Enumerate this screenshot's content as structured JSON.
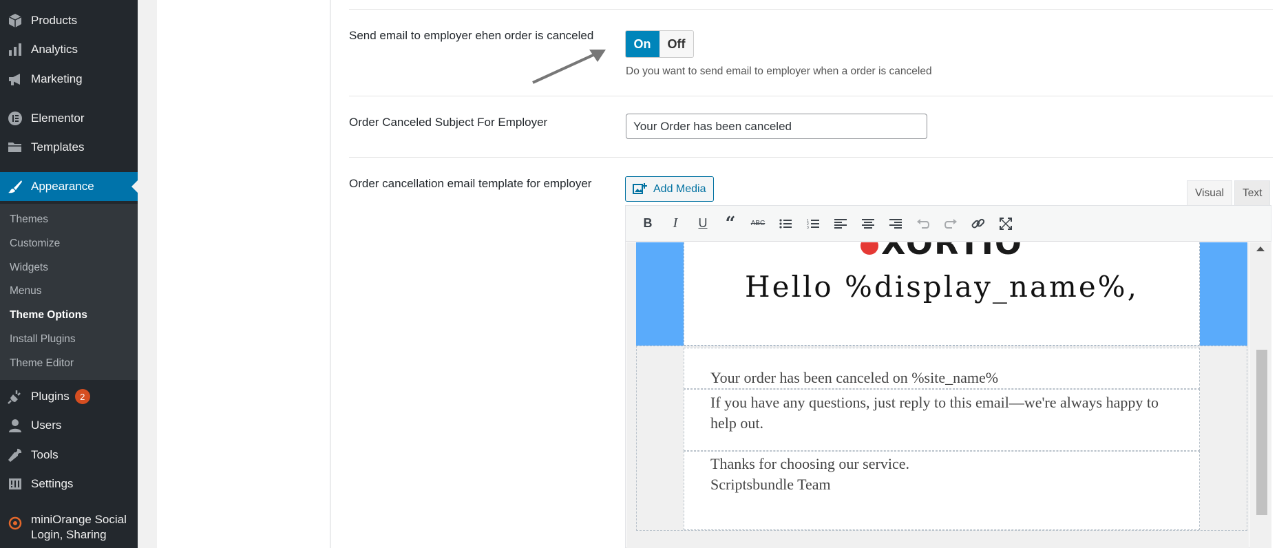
{
  "sidebar": {
    "items": [
      {
        "label": "Products",
        "icon": "cube-icon"
      },
      {
        "label": "Analytics",
        "icon": "bar-chart-icon"
      },
      {
        "label": "Marketing",
        "icon": "megaphone-icon"
      },
      {
        "label": "Elementor",
        "icon": "elementor-icon"
      },
      {
        "label": "Templates",
        "icon": "folder-icon"
      },
      {
        "label": "Appearance",
        "icon": "brush-icon"
      },
      {
        "label": "Plugins",
        "icon": "plug-icon",
        "badge": "2"
      },
      {
        "label": "Users",
        "icon": "user-icon"
      },
      {
        "label": "Tools",
        "icon": "wrench-icon"
      },
      {
        "label": "Settings",
        "icon": "settings-icon"
      },
      {
        "label": "miniOrange Social Login, Sharing",
        "icon": "miniorange-icon"
      }
    ],
    "submenu": [
      "Themes",
      "Customize",
      "Widgets",
      "Menus",
      "Theme Options",
      "Install Plugins",
      "Theme Editor"
    ],
    "active_color": "#0073aa"
  },
  "settings": {
    "send_email_label": "Send email to employer ehen order is canceled",
    "toggle_on": "On",
    "toggle_off": "Off",
    "toggle_state": "On",
    "toggle_desc": "Do you want to send email to employer when a order is canceled",
    "subject_label": "Order Canceled Subject For Employer",
    "subject_value": "Your Order has been canceled",
    "template_label": "Order cancellation email template for employer"
  },
  "editor": {
    "add_media": "Add Media",
    "tab_visual": "Visual",
    "tab_text": "Text",
    "toolbar": [
      "bold-icon",
      "italic-icon",
      "underline-icon",
      "blockquote-icon",
      "strikethrough-icon",
      "bullet-list-icon",
      "numbered-list-icon",
      "align-left-icon",
      "align-center-icon",
      "align-right-icon",
      "undo-icon",
      "redo-icon",
      "link-icon",
      "fullscreen-icon"
    ],
    "content": {
      "hello": "Hello %display_name%,",
      "line1": "Your order has been canceled on %site_name%",
      "line2": "If you have any questions, just reply to this email—we're always happy to help out.",
      "line3": "Thanks for choosing our service.",
      "line4": "Scriptsbundle Team"
    },
    "header_color": "#5aabfb"
  }
}
